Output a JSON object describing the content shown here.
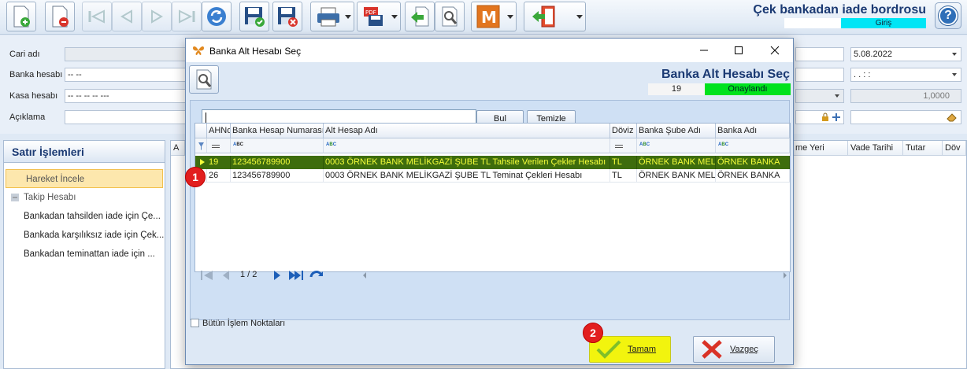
{
  "app": {
    "title": "Çek bankadan iade bordrosu",
    "mode": "Giriş",
    "help_icon": "question-icon",
    "toolbar_icons": [
      "new-document-icon",
      "delete-document-icon",
      "first-record-icon",
      "previous-record-icon",
      "next-record-icon",
      "last-record-icon",
      "refresh-icon",
      "save-icon",
      "save-close-icon",
      "print-icon",
      "pdf-export-icon",
      "back-icon",
      "search-tool-icon",
      "m-icon",
      "exit-icon"
    ]
  },
  "form": {
    "cari_label": "Cari adı",
    "bank_account_label": "Banka hesabı",
    "bank_account_value": "-- --",
    "cash_account_label": "Kasa hesabı",
    "cash_account_value": "-- -- -- -- ---",
    "description_label": "Açıklama",
    "date_value": "5.08.2022",
    "time_value": ".   .     :   :",
    "rate_value": "1,0000"
  },
  "left_panel": {
    "title": "Satır İşlemleri",
    "items": [
      {
        "label": "Hareket İncele"
      },
      {
        "label": "Takip Hesabı"
      },
      {
        "label": "Bankadan tahsilden iade için Çe..."
      },
      {
        "label": "Bankada karşılıksız iade için Çek..."
      },
      {
        "label": "Bankadan teminattan iade için ..."
      }
    ]
  },
  "background_grid": {
    "first_col": "A",
    "columns": [
      "me Yeri",
      "Vade Tarihi",
      "Tutar",
      "Döv"
    ]
  },
  "dialog": {
    "title": "Banka Alt Hesabı Seç",
    "heading": "Banka Alt Hesabı Seç",
    "count": "19",
    "status": "Onaylandı",
    "status_color": "#00e21d",
    "search_value": "",
    "find_button": "Bul",
    "clear_button": "Temizle",
    "columns": [
      "AHNo",
      "Banka Hesap Numarası",
      "Alt Hesap Adı",
      "Döviz",
      "Banka Şube Adı",
      "Banka Adı"
    ],
    "rows": [
      {
        "ahno": "19",
        "account_no": "123456789900",
        "sub_name": "0003 ÖRNEK BANK MELİKGAZİ ŞUBE TL Tahsile Verilen Çekler Hesabı",
        "currency": "TL",
        "branch": "ÖRNEK BANK MELİK",
        "bank": "ÖRNEK BANKA"
      },
      {
        "ahno": "26",
        "account_no": "123456789900",
        "sub_name": "0003 ÖRNEK BANK MELİKGAZİ ŞUBE TL Teminat Çekleri Hesabı",
        "currency": "TL",
        "branch": "ÖRNEK BANK MELİK",
        "bank": "ÖRNEK BANKA"
      }
    ],
    "selected_row_color": "#3e6d0d",
    "page_indicator": "1 / 2",
    "all_points_label": "Bütün İşlem Noktaları",
    "ok_button": "Tamam",
    "cancel_button": "Vazgeç"
  },
  "markers": {
    "m1": "1",
    "m2": "2"
  }
}
